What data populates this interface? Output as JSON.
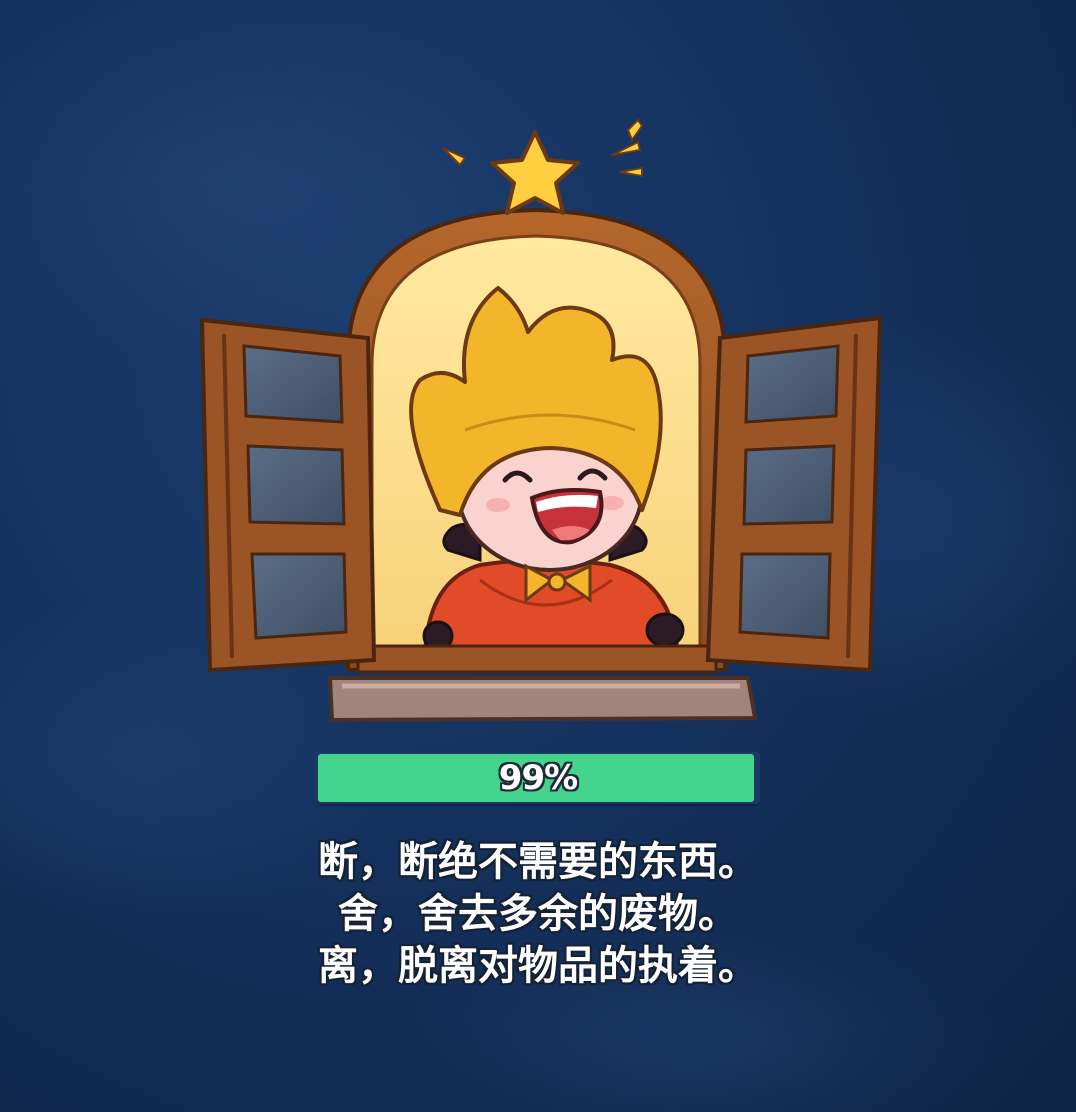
{
  "progress": {
    "label": "99%",
    "fraction": 0.99,
    "fill_color": "#45d48b"
  },
  "caption": {
    "lines": [
      "断，断绝不需要的东西。",
      "舍，舍去多余的废物。",
      "离，脱离对物品的执着。"
    ]
  },
  "colors": {
    "background": "#132c55",
    "window_frame": "#8a4a22",
    "character_hat": "#f3b52a",
    "character_cape": "#e14b28",
    "star": "#ffcf3f"
  },
  "icons": [
    "star-icon",
    "sparkle-icon"
  ]
}
